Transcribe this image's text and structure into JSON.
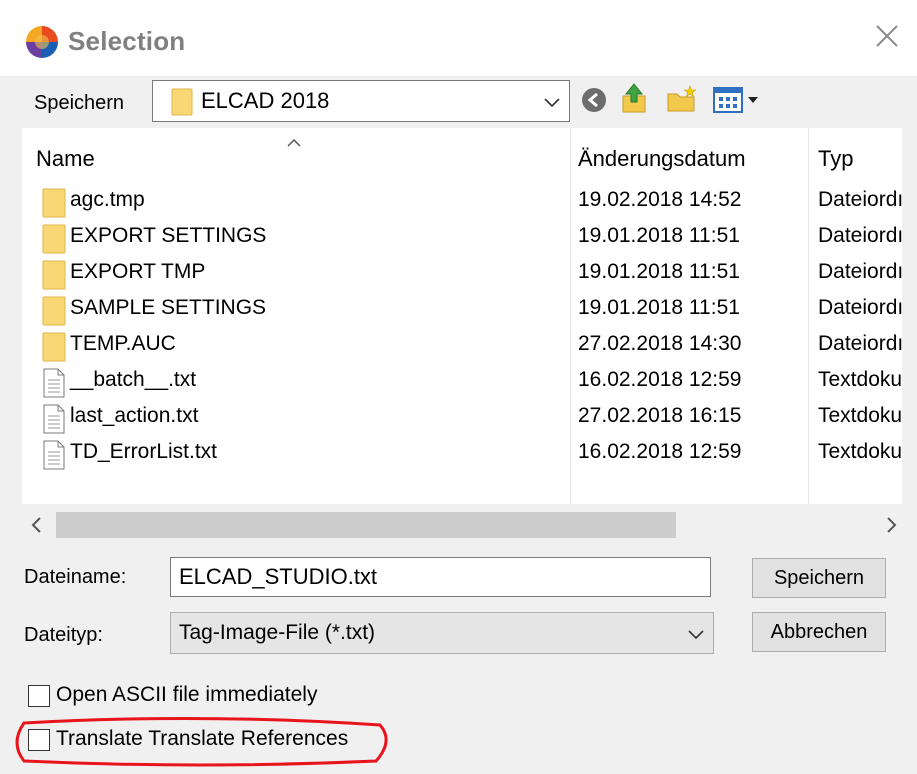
{
  "window": {
    "title": "Selection"
  },
  "save_in": {
    "label": "Speichern",
    "location": "ELCAD 2018"
  },
  "toolbar": {
    "icons": [
      "back-icon",
      "up-folder-icon",
      "new-folder-icon",
      "view-menu-icon"
    ]
  },
  "file_list": {
    "columns": [
      "Name",
      "Änderungsdatum",
      "Typ"
    ],
    "rows": [
      {
        "name": "agc.tmp",
        "date": "19.02.2018 14:52",
        "type": "Dateiordı",
        "icon": "folder"
      },
      {
        "name": "EXPORT SETTINGS",
        "date": "19.01.2018 11:51",
        "type": "Dateiordı",
        "icon": "folder"
      },
      {
        "name": "EXPORT TMP",
        "date": "19.01.2018 11:51",
        "type": "Dateiordı",
        "icon": "folder"
      },
      {
        "name": "SAMPLE SETTINGS",
        "date": "19.01.2018 11:51",
        "type": "Dateiordı",
        "icon": "folder"
      },
      {
        "name": "TEMP.AUC",
        "date": "27.02.2018 14:30",
        "type": "Dateiordı",
        "icon": "folder"
      },
      {
        "name": "__batch__.txt",
        "date": "16.02.2018 12:59",
        "type": "Textdoku",
        "icon": "text-file"
      },
      {
        "name": "last_action.txt",
        "date": "27.02.2018 16:15",
        "type": "Textdoku",
        "icon": "text-file"
      },
      {
        "name": "TD_ErrorList.txt",
        "date": "16.02.2018 12:59",
        "type": "Textdoku",
        "icon": "text-file"
      }
    ]
  },
  "filename": {
    "label": "Dateiname:",
    "value": "ELCAD_STUDIO.txt"
  },
  "filetype": {
    "label": "Dateityp:",
    "value": "Tag-Image-File (*.txt)"
  },
  "buttons": {
    "save": "Speichern",
    "cancel": "Abbrechen"
  },
  "options": {
    "open_ascii": {
      "label": "Open ASCII file immediately",
      "checked": false
    },
    "translate_refs": {
      "label": "Translate Translate References",
      "checked": false
    }
  },
  "colors": {
    "folder": "#f8d775",
    "highlight_ring": "#e8141b"
  }
}
